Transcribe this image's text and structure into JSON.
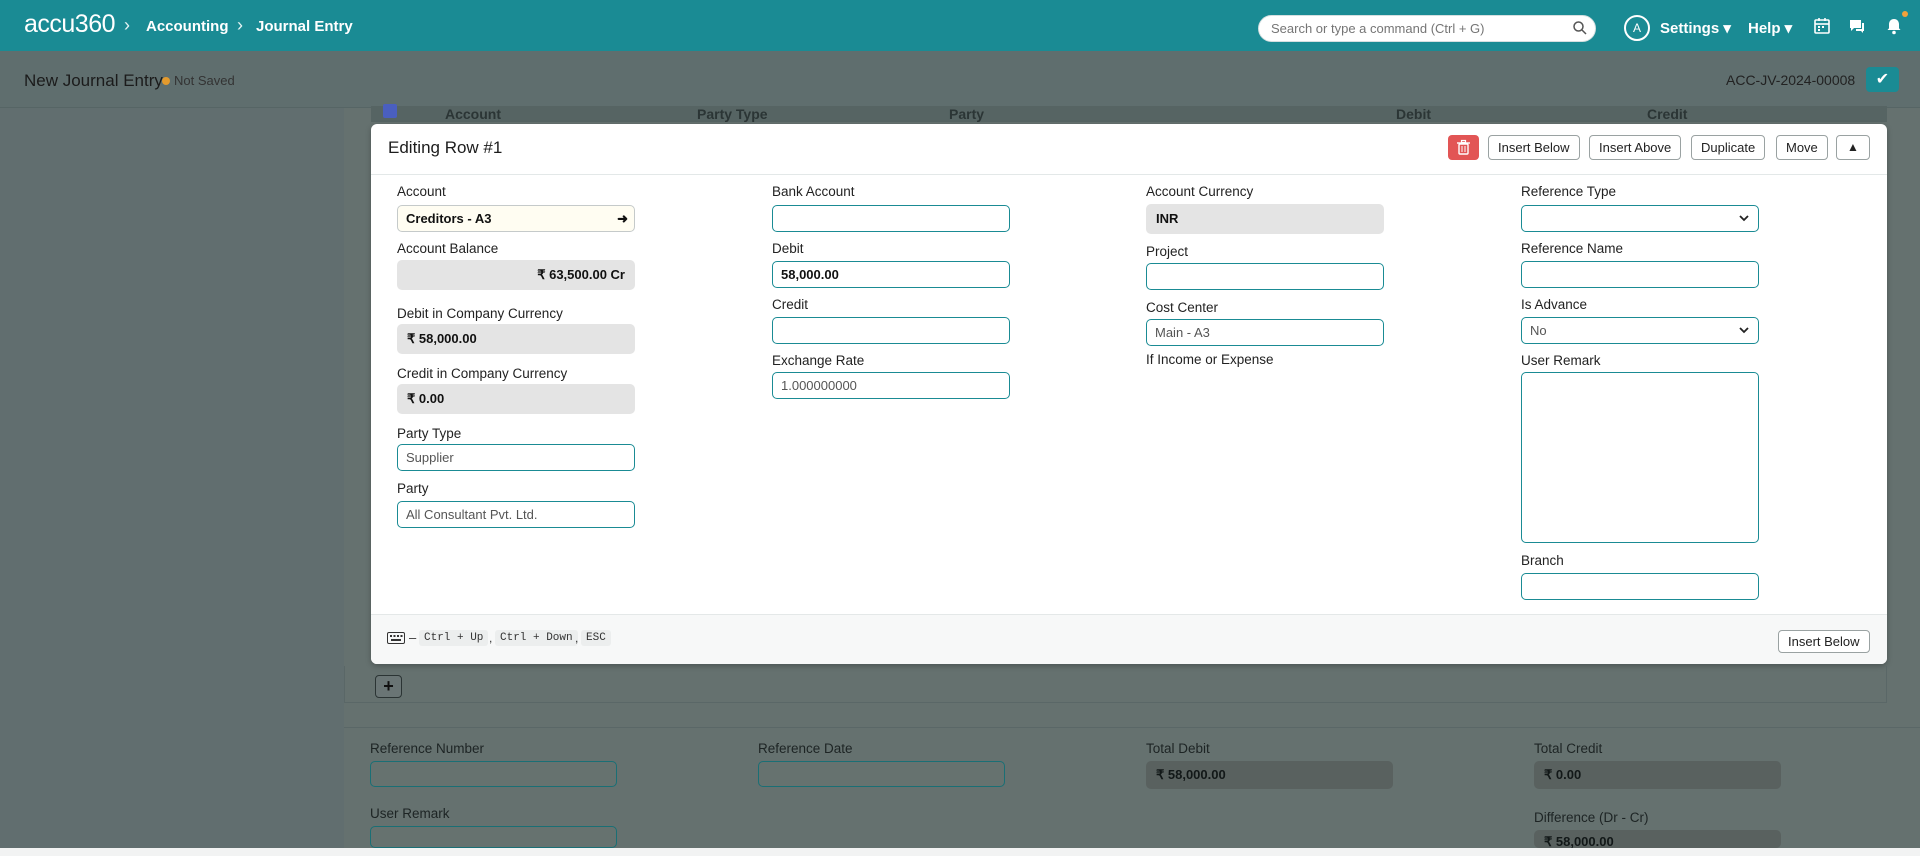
{
  "navbar": {
    "logo": "accu360",
    "breadcrumbs": [
      "Accounting",
      "Journal Entry"
    ],
    "search_placeholder": "Search or type a command (Ctrl + G)",
    "avatar_letter": "A",
    "settings_label": "Settings",
    "help_label": "Help"
  },
  "page": {
    "title": "New Journal Entry",
    "status": "Not Saved",
    "doc_id": "ACC-JV-2024-00008",
    "save_icon": "check-icon"
  },
  "grid": {
    "columns": [
      "Account",
      "Party Type",
      "Party",
      "Debit",
      "Credit"
    ]
  },
  "panel": {
    "title": "Editing Row #1",
    "buttons": {
      "insert_below": "Insert Below",
      "insert_above": "Insert Above",
      "duplicate": "Duplicate",
      "move": "Move"
    },
    "col1": {
      "account_label": "Account",
      "account_value": "Creditors - A3",
      "account_balance_label": "Account Balance",
      "account_balance_value": "₹ 63,500.00 Cr",
      "debit_company_label": "Debit in Company Currency",
      "debit_company_value": "₹ 58,000.00",
      "credit_company_label": "Credit in Company Currency",
      "credit_company_value": "₹ 0.00",
      "party_type_label": "Party Type",
      "party_type_value": "Supplier",
      "party_label": "Party",
      "party_value": "All Consultant Pvt. Ltd."
    },
    "col2": {
      "bank_account_label": "Bank Account",
      "bank_account_value": "",
      "debit_label": "Debit",
      "debit_value": "58,000.00",
      "credit_label": "Credit",
      "credit_value": "",
      "exchange_rate_label": "Exchange Rate",
      "exchange_rate_value": "1.000000000"
    },
    "col3": {
      "account_currency_label": "Account Currency",
      "account_currency_value": "INR",
      "project_label": "Project",
      "project_value": "",
      "cost_center_label": "Cost Center",
      "cost_center_value": "Main - A3",
      "income_expense_note": "If Income or Expense"
    },
    "col4": {
      "reference_type_label": "Reference Type",
      "reference_type_value": "",
      "reference_name_label": "Reference Name",
      "reference_name_value": "",
      "is_advance_label": "Is Advance",
      "is_advance_value": "No",
      "user_remark_label": "User Remark",
      "branch_label": "Branch",
      "branch_value": ""
    },
    "footer": {
      "dash": "–",
      "shortcut1": "Ctrl + Up",
      "shortcut2": "Ctrl + Down",
      "shortcut3": "ESC",
      "comma": ",",
      "insert_below": "Insert Below"
    }
  },
  "add_row_label": "+",
  "bottom": {
    "reference_number_label": "Reference Number",
    "reference_date_label": "Reference Date",
    "total_debit_label": "Total Debit",
    "total_debit_value": "₹ 58,000.00",
    "total_credit_label": "Total Credit",
    "total_credit_value": "₹ 0.00",
    "user_remark_label": "User Remark",
    "difference_label": "Difference (Dr - Cr)",
    "difference_value": "₹ 58,000.00"
  }
}
